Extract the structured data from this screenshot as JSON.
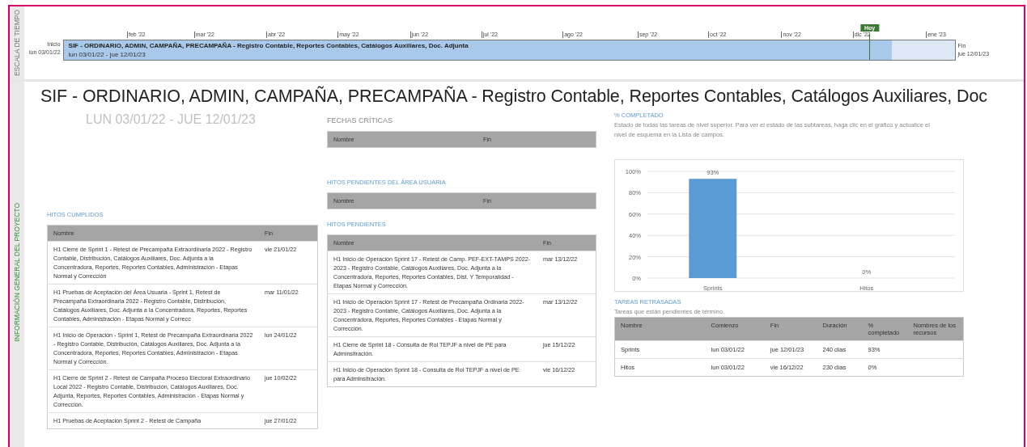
{
  "timeline": {
    "section_label": "ESCALA DE TIEMPO",
    "start_label": "Inicio",
    "start_date": "lun 03/01/22",
    "end_label": "Fin",
    "end_date": "jue 12/01/23",
    "today_label": "Hoy",
    "months": [
      "feb '22",
      "mar '22",
      "abr '22",
      "may '22",
      "jun '22",
      "jul '22",
      "ago '22",
      "sep '22",
      "oct '22",
      "nov '22",
      "dic '22",
      "ene '23"
    ],
    "bar": {
      "title": "SIF - ORDINARIO, ADMIN, CAMPAÑA, PRECAMPAÑA - Registro Contable, Reportes Contables, Catálogos Auxiliares, Doc. Adjunta",
      "dates": "lun 03/01/22 - jue 12/01/23",
      "level": 0.93
    }
  },
  "overview": {
    "section_label": "INFORMACIÓN GENERAL DEL PROYECTO",
    "title": "SIF - ORDINARIO, ADMIN, CAMPAÑA, PRECAMPAÑA - Registro Contable, Reportes Contables, Catálogos Auxiliares, Doc",
    "date_range": "LUN 03/01/22  - JUE 12/01/23",
    "hitos_cumplidos": {
      "heading": "HITOS CUMPLIDOS",
      "columns": [
        "Nombre",
        "Fin"
      ],
      "rows": [
        [
          "H1 Cierre de Sprint 1 - Retest de Precampaña Extraordinaria 2022 - Registro Contable, Distribución, Catálogos Auxiliares, Doc. Adjunta a la Concentradora, Reportes, Reportes Contables, Administración - Etapas Normal y Corrección",
          "vie 21/01/22"
        ],
        [
          "H1 Pruebas de Aceptación del Área Usuaria - Sprint 1, Retest de Precampaña Extraordinaria 2022 - Registro Contable, Distribución, Catálogos Auxiliares, Doc. Adjunta a la Concentradora, Reportes, Reportes Contables, Administración - Etapas Normal y Correcc",
          "mar 11/01/22"
        ],
        [
          "H1 Inicio de Operación - Sprint 1, Retest de Precampaña Extraordinaria 2022 - Registro Contable, Distribución, Catálogos Auxiliares, Doc. Adjunta a la Concentradora, Reportes, Reportes Contables, Administración - Etapas Normal y Corrección.",
          "lun 24/01/22"
        ],
        [
          "H1 Cierre de Sprint 2 - Retest de Campaña Proceso Electoral Extraordinario Local 2022 - Registro Contable, Distribución, Catálogos Auxiliares, Doc. Adjunta, Reportes, Reportes Contables, Administración - Etapas Normal y Corrección.",
          "jue 10/02/22"
        ],
        [
          "H1 Pruebas de Aceptación Sprint 2 - Retest de Campaña",
          "jue 27/01/22"
        ]
      ]
    },
    "fechas_criticas": {
      "heading": "FECHAS CRÍTICAS",
      "columns": [
        "Nombre",
        "Fin"
      ]
    },
    "hitos_area_usuaria": {
      "heading": "HITOS PENDIENTES DEL ÁREA USUARIA",
      "columns": [
        "Nombre",
        "Fin"
      ]
    },
    "hitos_pendientes": {
      "heading": "HITOS PENDIENTES",
      "columns": [
        "Nombre",
        "Fin"
      ],
      "rows": [
        [
          "H1 Inicio de Operación Sprint 17 - Retest de Camp. PEF-EXT-TAMPS 2022-2023 - Registro Contable, Catálogos Auxiliares, Doc. Adjunta a la Concentradora, Reportes, Reportes Contables, Dist. Y Temporalidad - Etapas Normal y Corrección.",
          "mar 13/12/22"
        ],
        [
          "H1 Inicio de Operación Sprint 17 - Retest de Precampaña Ordinaria 2022-2023 - Registro Contable, Catálogos Auxiliares, Doc. Adjunta a la Concentradora, Reportes, Reportes Contables - Etapas Normal y Corrección.",
          "mar 13/12/22"
        ],
        [
          "H1 Cierre de Sprint 18 - Consulta de Rol TEPJF a nivel de PE para Adminsitración.",
          "jue 15/12/22"
        ],
        [
          "H1 Inicio de Operación Sprint 18 - Consulta de Rol TEPJF a nivel de PE para Adminsitración.",
          "vie 16/12/22"
        ]
      ]
    },
    "completado": {
      "heading": "% COMPLETADO",
      "description": "Estado de todas las tareas de nivel superior. Para ver el estado de las subtareas, haga clic en el gráfico y actualice el nivel de esquema en la Lista de campos.",
      "chart_data": {
        "type": "bar",
        "categories": [
          "Sprints",
          "Hitos"
        ],
        "series": [
          {
            "color": "#5b9bd5",
            "values": [
              93,
              0
            ]
          }
        ],
        "grid": true,
        "ylim": [
          0,
          100
        ],
        "yticks": [
          {
            "value": 0,
            "label": "0%"
          },
          {
            "value": 20,
            "label": "20%"
          },
          {
            "value": 40,
            "label": "40%"
          },
          {
            "value": 60,
            "label": "60%"
          },
          {
            "value": 80,
            "label": "80%"
          },
          {
            "value": 100,
            "label": "100%"
          }
        ],
        "value_labels": [
          "93%",
          "0%"
        ]
      }
    },
    "tareas_retrasadas": {
      "heading": "TAREAS RETRASADAS",
      "description": "Tareas que están pendientes de término.",
      "columns": [
        "Nombre",
        "Comienzo",
        "Fin",
        "Duración",
        "% completado",
        "Nombres de los recursos"
      ],
      "rows": [
        [
          "Sprints",
          "lun 03/01/22",
          "jue 12/01/23",
          "240 días",
          "93%"
        ],
        [
          "Hitos",
          "lun 03/01/22",
          "vie 16/12/22",
          "230 días",
          "0%"
        ]
      ]
    }
  }
}
